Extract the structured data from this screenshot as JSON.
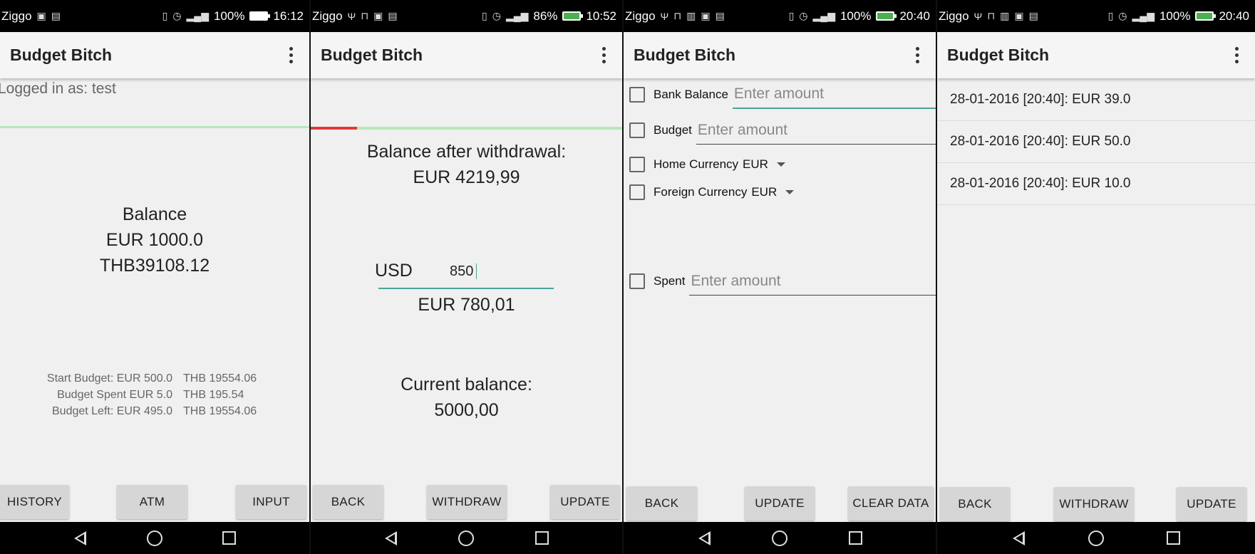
{
  "app_title": "Budget Bitch",
  "screens": {
    "s1": {
      "status": {
        "carrier": "Ziggo",
        "battery": "100%",
        "time": "16:12"
      },
      "logged_in": "Logged in as: test",
      "balance": {
        "label": "Balance",
        "eur": "EUR 1000.0",
        "thb": "THB39108.12"
      },
      "stats": [
        {
          "a": "Start Budget: EUR 500.0",
          "b": "THB 19554.06"
        },
        {
          "a": "Budget Spent EUR 5.0",
          "b": "THB 195.54"
        },
        {
          "a": "Budget Left:  EUR 495.0",
          "b": "THB 19554.06"
        }
      ],
      "buttons": {
        "history": "HISTORY",
        "atm": "ATM",
        "input": "INPUT"
      }
    },
    "s2": {
      "status": {
        "carrier": "Ziggo",
        "battery": "86%",
        "time": "10:52"
      },
      "after_label": "Balance after withdrawal:",
      "after_value": "EUR 4219,99",
      "currency_label": "USD",
      "amount_value": "850",
      "converted": "EUR 780,01",
      "current_label": "Current balance:",
      "current_value": "5000,00",
      "buttons": {
        "back": "BACK",
        "withdraw": "WITHDRAW",
        "update": "UPDATE"
      }
    },
    "s3": {
      "status": {
        "carrier": "Ziggo",
        "battery": "100%",
        "time": "20:40"
      },
      "bank_balance_label": "Bank Balance",
      "budget_label": "Budget",
      "home_currency_label": "Home Currency",
      "home_currency_value": "EUR",
      "foreign_currency_label": "Foreign Currency",
      "foreign_currency_value": "EUR",
      "spent_label": "Spent",
      "placeholder": "Enter amount",
      "buttons": {
        "back": "BACK",
        "update": "UPDATE",
        "clear": "CLEAR DATA"
      }
    },
    "s4": {
      "status": {
        "carrier": "Ziggo",
        "battery": "100%",
        "time": "20:40"
      },
      "history": [
        "28-01-2016 [20:40]: EUR 39.0",
        "28-01-2016 [20:40]: EUR 50.0",
        "28-01-2016 [20:40]: EUR 10.0"
      ],
      "buttons": {
        "back": "BACK",
        "withdraw": "WITHDRAW",
        "update": "UPDATE"
      }
    }
  },
  "colors": {
    "accent": "#4aa39a",
    "progress_track": "#b8e6b8",
    "progress_fill": "#e53935"
  }
}
